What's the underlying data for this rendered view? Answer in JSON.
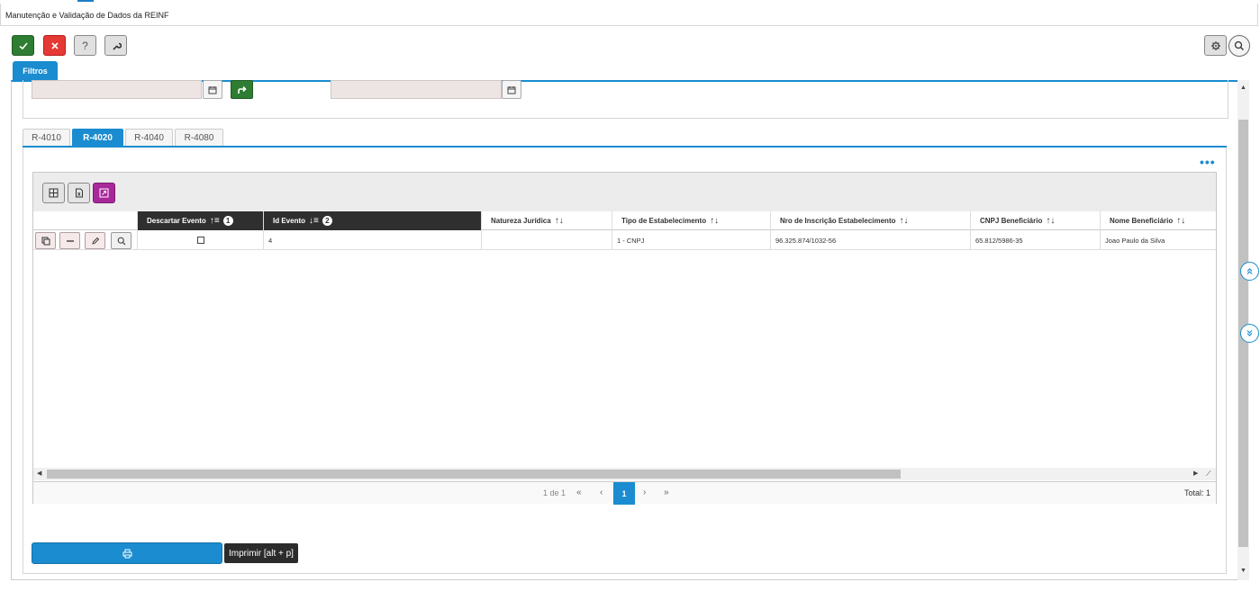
{
  "window": {
    "title": "Manutenção e Validação de Dados da REINF"
  },
  "toolbar": {
    "help_label": "?"
  },
  "filters": {
    "tab_label": "Filtros"
  },
  "tabs": [
    {
      "label": "R-4010",
      "active": false
    },
    {
      "label": "R-4020",
      "active": true
    },
    {
      "label": "R-4040",
      "active": false
    },
    {
      "label": "R-4080",
      "active": false
    }
  ],
  "grid": {
    "columns": [
      {
        "label": "Descartar Evento",
        "sort": "asc",
        "order": "1"
      },
      {
        "label": "Id Evento",
        "sort": "desc",
        "order": "2"
      },
      {
        "label": "Natureza Jurídica",
        "sort": "none"
      },
      {
        "label": "Tipo de Estabelecimento",
        "sort": "none"
      },
      {
        "label": "Nro de Inscrição Estabelecimento",
        "sort": "none"
      },
      {
        "label": "CNPJ Beneficiário",
        "sort": "none"
      },
      {
        "label": "Nome Beneficiário",
        "sort": "none"
      }
    ],
    "rows": [
      {
        "descartar": false,
        "id_evento": "4",
        "natureza": "",
        "tipo_estab": "1 - CNPJ",
        "nro_inscricao": "96.325.874/1032-56",
        "cnpj_benef": "65.812/5986-35",
        "nome_benef": "Joao Paulo da Silva"
      }
    ],
    "pager": {
      "info": "1 de 1",
      "current_page": "1",
      "total": "Total: 1"
    }
  },
  "print": {
    "tooltip": "Imprimir [alt + p]"
  },
  "colors": {
    "accent": "#1a8ccf",
    "ok": "#2e7d32",
    "cancel": "#e53935",
    "purple": "#a8279a",
    "header_dark": "#2f2f2f"
  }
}
